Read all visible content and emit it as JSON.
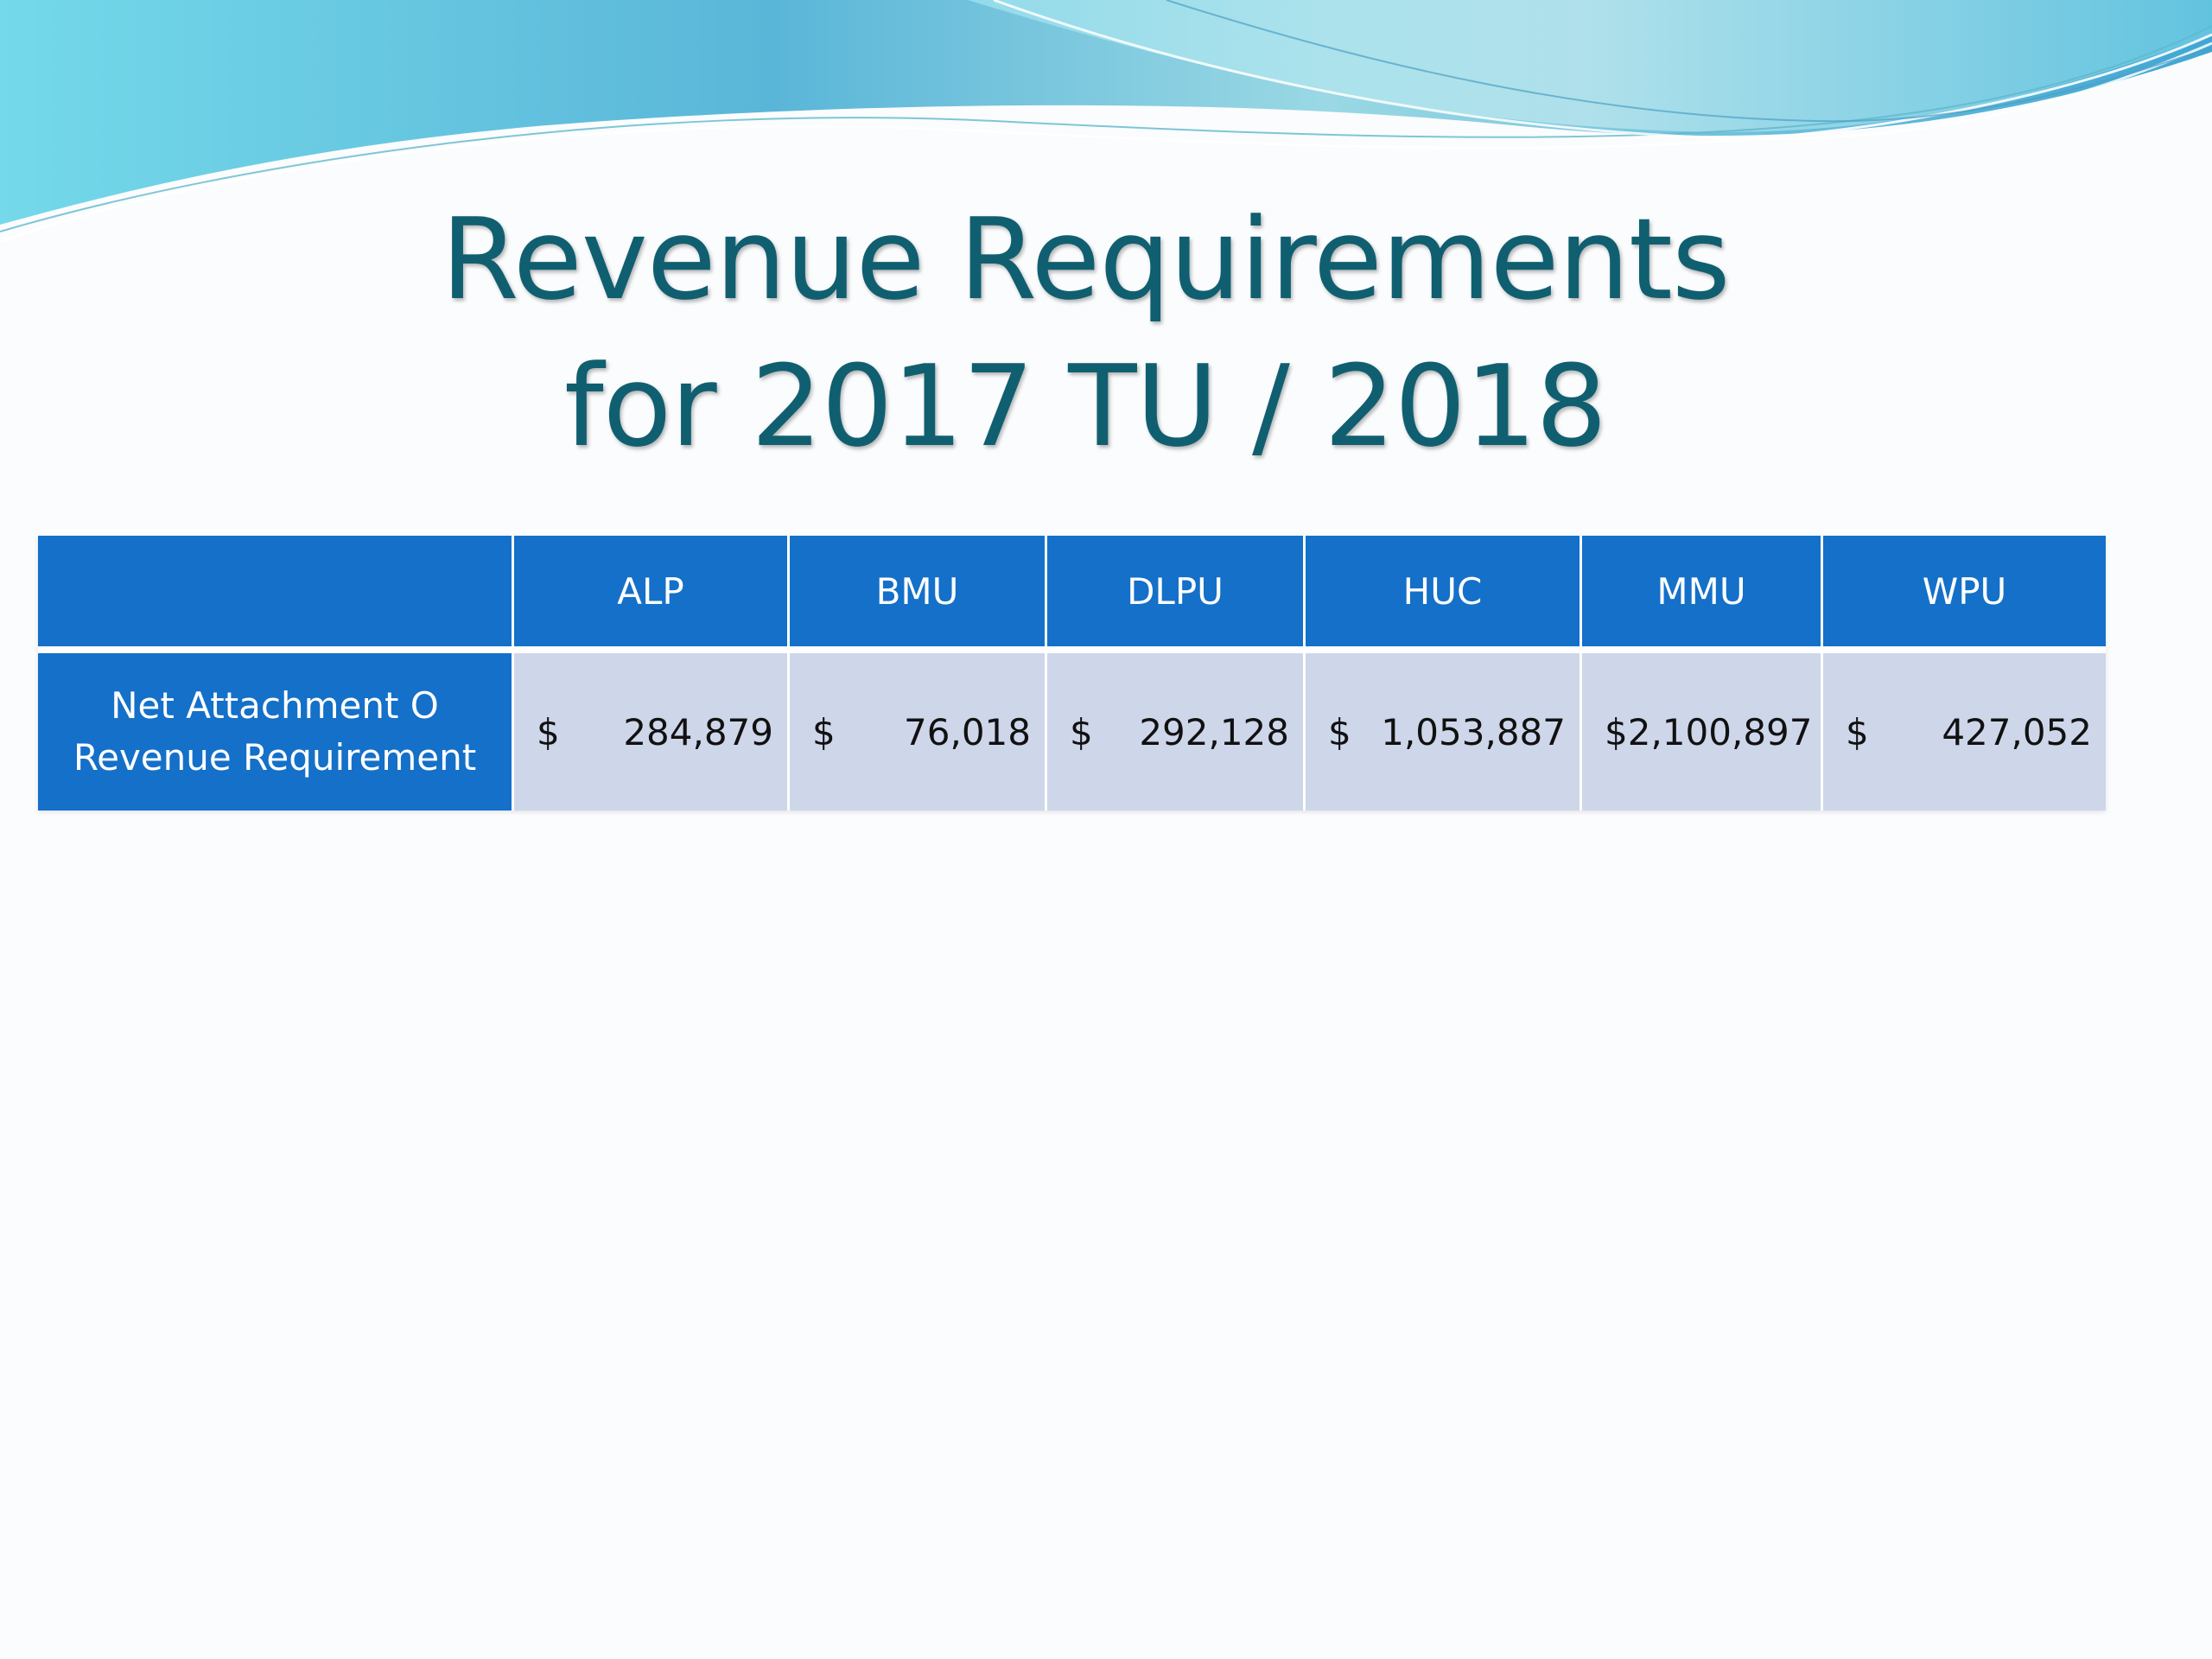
{
  "slide": {
    "title_line1": "Revenue Requirements",
    "title_line2": "for 2017 TU / 2018"
  },
  "table": {
    "headers": [
      "",
      "ALP",
      "BMU",
      "DLPU",
      "HUC",
      "MMU",
      "WPU"
    ],
    "rows": [
      {
        "label_line1": "Net Attachment O",
        "label_line2": "Revenue Requirement",
        "cells": [
          {
            "currency": "$",
            "amount": "284,879"
          },
          {
            "currency": "$",
            "amount": "76,018"
          },
          {
            "currency": "$",
            "amount": "292,128"
          },
          {
            "currency": "$",
            "amount": "1,053,887"
          },
          {
            "currency": "$",
            "amount": "2,100,897"
          },
          {
            "currency": "$",
            "amount": "427,052"
          }
        ]
      }
    ]
  },
  "colors": {
    "title": "#105f70",
    "header_blue": "#1470c8",
    "data_cell": "#ced6ea"
  }
}
